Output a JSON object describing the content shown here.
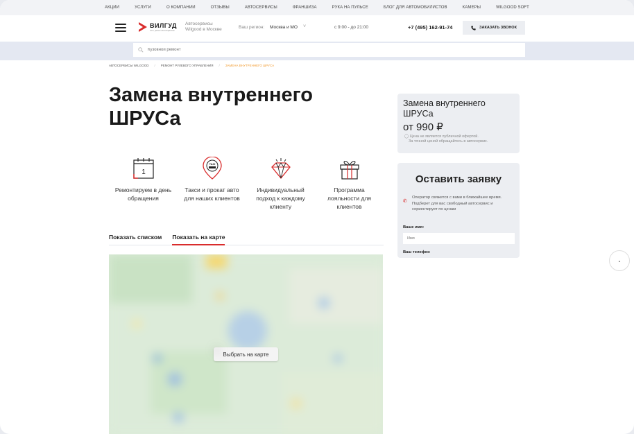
{
  "topnav": [
    "Акции",
    "Услуги",
    "О компании",
    "Отзывы",
    "Автосервисы",
    "Франшиза",
    "Рука на пульсе",
    "Блог для автомобилистов",
    "Камеры",
    "Wilgood soft"
  ],
  "header": {
    "logo_word": "ВИЛГУД",
    "logo_sub": "сеть умных автосервисов",
    "logo_tag_line1": "Автосервисы",
    "logo_tag_line2": "Wilgood в Москве",
    "region_label": "Ваш регион:",
    "region_value": "Москва и МО",
    "region_arrow": "˅",
    "hours": "с 9:00 - до 21:00",
    "phone": "+7 (495) 162-91-74",
    "call_button": "Заказать звонок"
  },
  "search": {
    "placeholder": "Кузовной ремонт"
  },
  "breadcrumb": [
    "Автосервисы Wilgood",
    "Ремонт рулевого управления",
    "Замена внутреннего ШРУСа"
  ],
  "title": "Замена внутреннего ШРУСа",
  "calendar_day": "1",
  "taxi_label": "TAXI",
  "features": [
    {
      "icon": "calendar-icon",
      "text": "Ремонтируем в день обращения"
    },
    {
      "icon": "taxi-icon",
      "text": "Такси и прокат авто для наших клиентов"
    },
    {
      "icon": "diamond-icon",
      "text": "Индивидуальный подход к каждому клиенту"
    },
    {
      "icon": "gift-icon",
      "text": "Программа лояльности для клиентов"
    }
  ],
  "tabs": {
    "list": "Показать списком",
    "map": "Показать на карте"
  },
  "map": {
    "button": "Выбрать на карте"
  },
  "price_card": {
    "title": "Замена внутреннего ШРУСа",
    "price": "от 990 ₽",
    "note_line1": "Цена не является публичной офертой.",
    "note_line2": "За точной ценой обращайтесь в автосервис."
  },
  "form": {
    "title": "Оставить заявку",
    "note": "Оператор свяжется с вами в ближайшее время. Подберет для вас свободный автосервис и сориентирует по ценам",
    "name_label": "Ваше имя:",
    "name_placeholder": "Имя",
    "phone_label": "Ваш телефон"
  },
  "colors": {
    "accent": "#d92c2c",
    "breadcrumb_current": "#f29a2e",
    "card_bg": "#eceef2"
  }
}
